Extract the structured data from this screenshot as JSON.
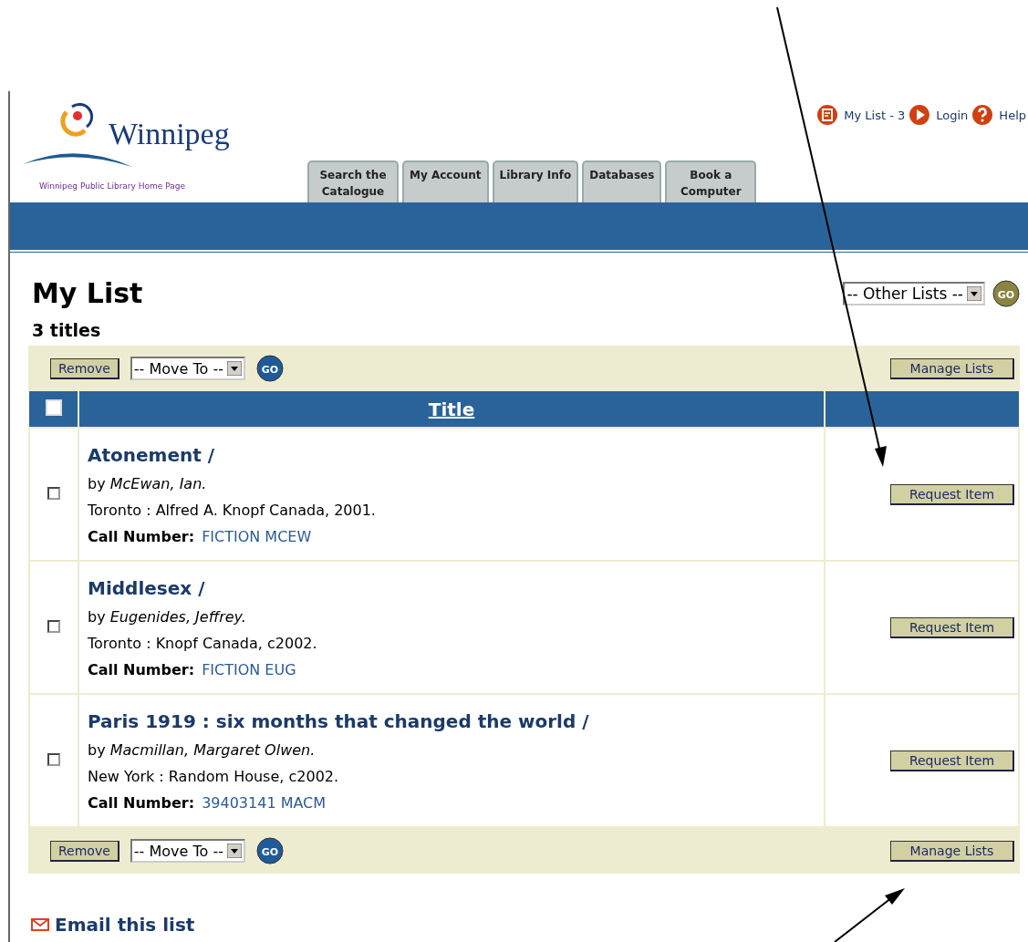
{
  "header": {
    "logo_text": "Winnipeg",
    "home_link": "Winnipeg Public Library Home Page",
    "top_links": [
      {
        "kind": "list",
        "label": "My List - 3"
      },
      {
        "kind": "login",
        "label": "Login"
      },
      {
        "kind": "help",
        "label": "Help"
      }
    ],
    "tabs": [
      {
        "label": "Search the Catalogue"
      },
      {
        "label": "My Account"
      },
      {
        "label": "Library Info"
      },
      {
        "label": "Databases"
      },
      {
        "label": "Book a Computer"
      }
    ]
  },
  "page": {
    "title": "My List",
    "other_lists": "-- Other Lists --",
    "go": "GO",
    "count": "3 titles"
  },
  "toolbars": [
    {
      "remove": "Remove",
      "move_to": "-- Move To --",
      "go": "GO",
      "manage": "Manage Lists"
    },
    {
      "remove": "Remove",
      "move_to": "-- Move To --",
      "go": "GO",
      "manage": "Manage Lists"
    }
  ],
  "table": {
    "select_all_checked": false,
    "title_column": "Title",
    "rows": [
      {
        "checked": false,
        "title": "Atonement /",
        "author": "by *McEwan, Ian.*",
        "publisher": "Toronto : Alfred A. Knopf Canada, 2001.",
        "call_label": "Call Number:",
        "call_number": "FICTION MCEW",
        "action": "Request Item"
      },
      {
        "checked": false,
        "title": "Middlesex /",
        "author": "by *Eugenides, Jeffrey.*",
        "publisher": "Toronto : Knopf Canada, c2002.",
        "call_label": "Call Number:",
        "call_number": "FICTION EUG",
        "action": "Request Item"
      },
      {
        "checked": false,
        "title": "Paris 1919 : six months that changed the world /",
        "author": "by *Macmillan, Margaret Olwen.*",
        "publisher": "New York : Random House, c2002.",
        "call_label": "Call Number:",
        "call_number": "39403141 MACM",
        "action": "Request Item"
      }
    ]
  },
  "email_link": "Email this list"
}
